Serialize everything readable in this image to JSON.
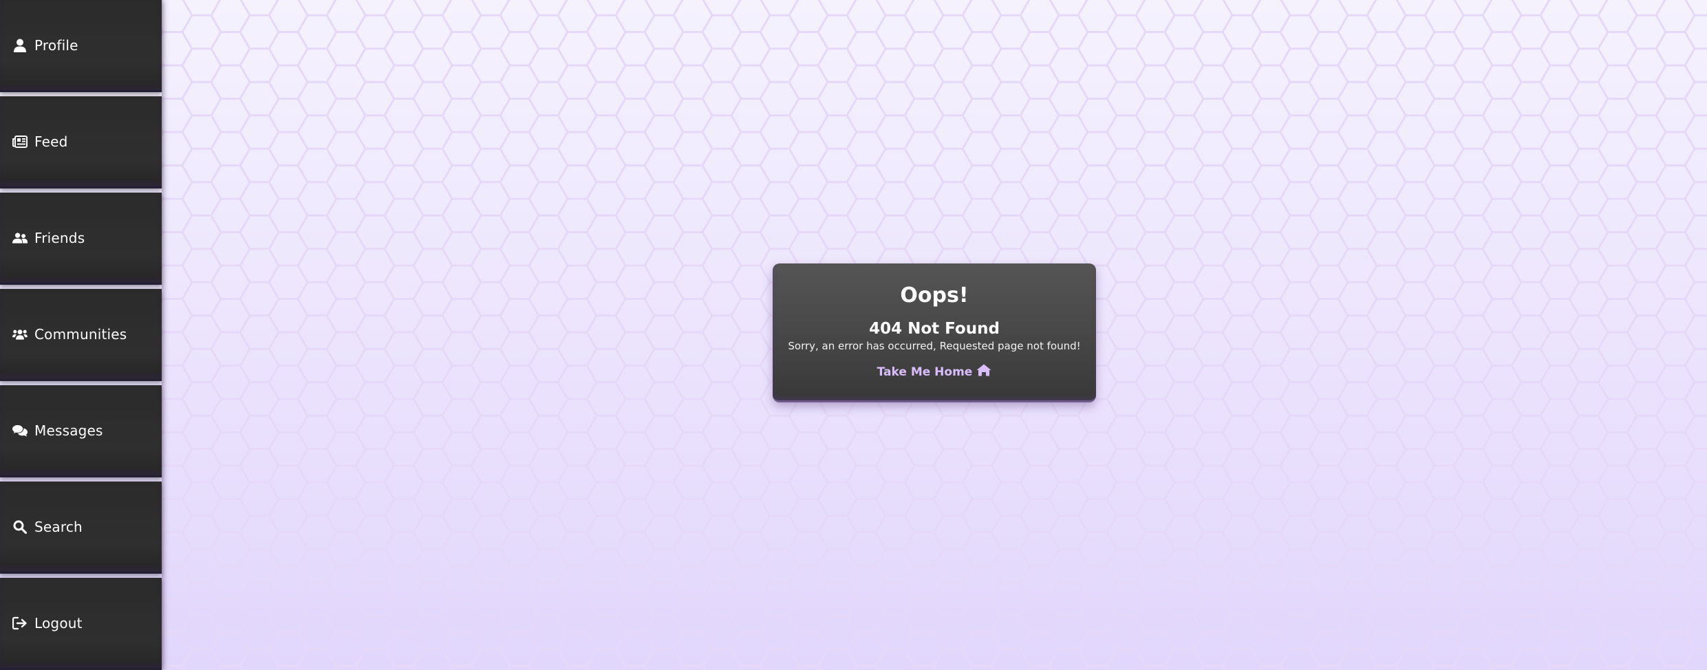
{
  "sidebar": {
    "items": [
      {
        "label": "Profile",
        "icon": "user-icon"
      },
      {
        "label": "Feed",
        "icon": "newspaper-icon"
      },
      {
        "label": "Friends",
        "icon": "friends-icon"
      },
      {
        "label": "Communities",
        "icon": "users-group-icon"
      },
      {
        "label": "Messages",
        "icon": "comments-icon"
      },
      {
        "label": "Search",
        "icon": "search-icon"
      },
      {
        "label": "Logout",
        "icon": "logout-icon"
      }
    ]
  },
  "error": {
    "title": "Oops!",
    "code": "404 Not Found",
    "message": "Sorry, an error has occurred, Requested page not found!",
    "home_link": "Take Me Home",
    "home_icon": "home-icon"
  },
  "colors": {
    "sidebar_bg": "#2b2b2b",
    "card_bg": "#4a4a4a",
    "link_accent": "#d9bdfd",
    "page_bg_top": "#f5f2fe",
    "page_bg_bottom": "#e1d6fc",
    "hex_stroke": "#e6d8f8"
  }
}
